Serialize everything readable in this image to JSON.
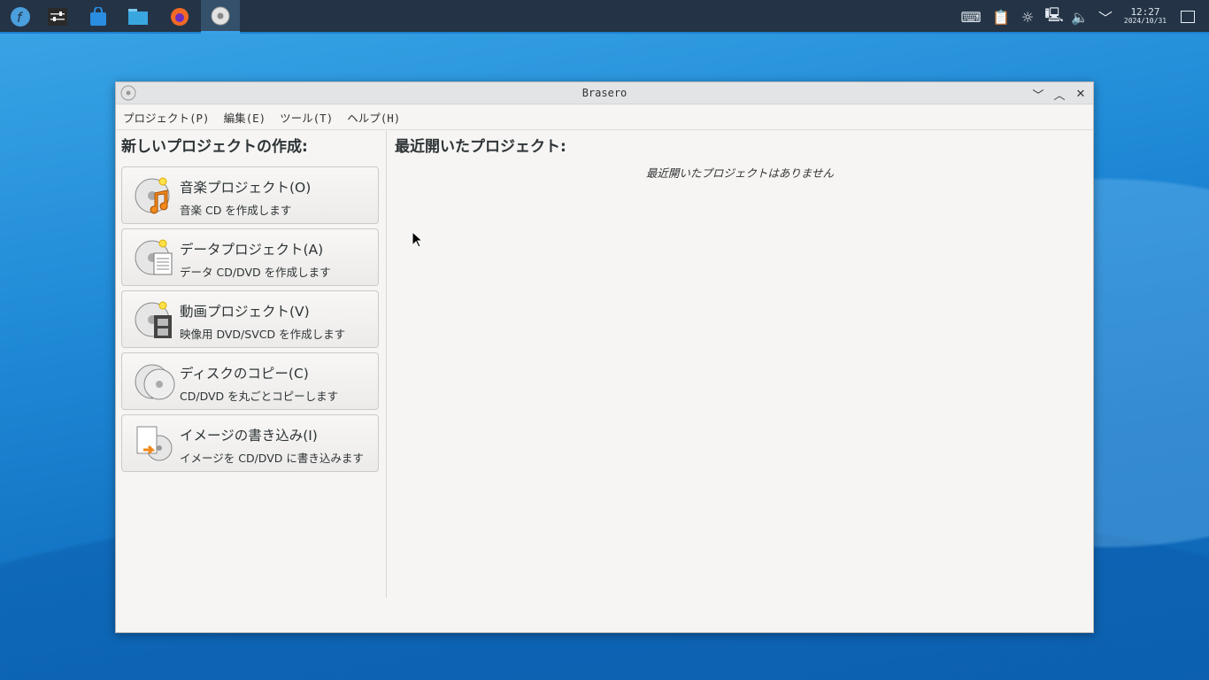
{
  "taskbar": {
    "apps": [
      {
        "name": "fedora-menu"
      },
      {
        "name": "settings"
      },
      {
        "name": "software"
      },
      {
        "name": "files"
      },
      {
        "name": "firefox"
      },
      {
        "name": "brasero",
        "active": true
      }
    ],
    "clock": {
      "time": "12:27",
      "date": "2024/10/31"
    }
  },
  "window": {
    "title": "Brasero",
    "menu": [
      "プロジェクト(P)",
      "編集(E)",
      "ツール(T)",
      "ヘルプ(H)"
    ],
    "new_heading": "新しいプロジェクトの作成:",
    "projects": [
      {
        "title": "音楽プロジェクト(O)",
        "desc": "音楽 CD を作成します",
        "icon": "music"
      },
      {
        "title": "データプロジェクト(A)",
        "desc": "データ CD/DVD を作成します",
        "icon": "data"
      },
      {
        "title": "動画プロジェクト(V)",
        "desc": "映像用 DVD/SVCD を作成します",
        "icon": "video"
      },
      {
        "title": "ディスクのコピー(C)",
        "desc": "CD/DVD を丸ごとコピーします",
        "icon": "copy"
      },
      {
        "title": "イメージの書き込み(I)",
        "desc": "イメージを CD/DVD に書き込みます",
        "icon": "image"
      }
    ],
    "recent_heading": "最近開いたプロジェクト:",
    "recent_empty": "最近開いたプロジェクトはありません"
  }
}
